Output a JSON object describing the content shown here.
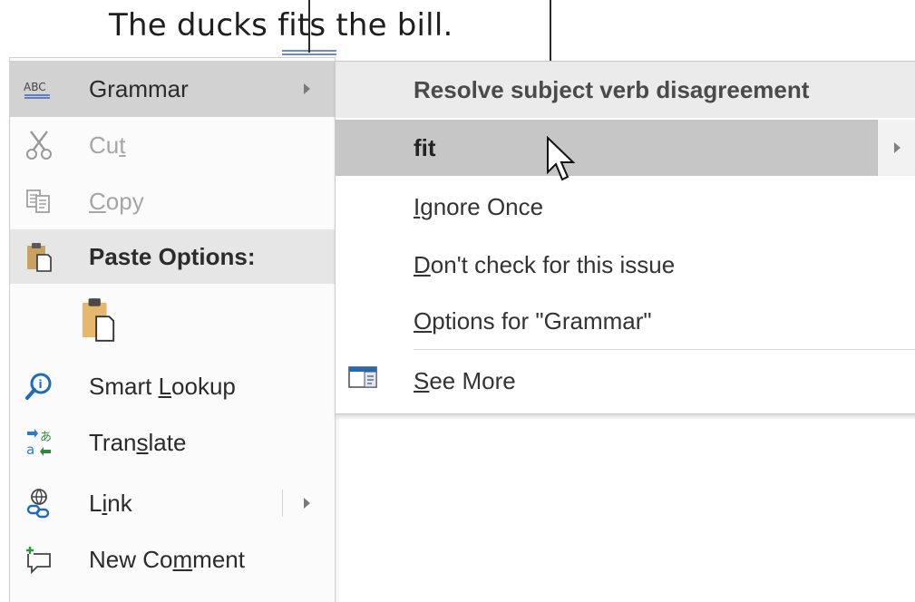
{
  "document": {
    "text_before": "The ducks ",
    "text_flagged": "fits",
    "text_after": " the bill."
  },
  "context_menu": {
    "items": [
      {
        "label": "Grammar",
        "icon": "abc-grammar-icon",
        "has_submenu": true
      },
      {
        "label": "Cut",
        "icon": "scissors-icon",
        "disabled": true
      },
      {
        "label": "Copy",
        "icon": "copy-icon",
        "disabled": true
      },
      {
        "label": "Paste Options:",
        "icon": "clipboard-icon"
      },
      {
        "label": "",
        "icon": "paste-keep-text-icon"
      },
      {
        "label": "Smart Lookup",
        "icon": "smart-lookup-icon"
      },
      {
        "label": "Translate",
        "icon": "translate-icon"
      },
      {
        "label": "Link",
        "icon": "link-icon",
        "has_submenu": true
      },
      {
        "label": "New Comment",
        "icon": "new-comment-icon"
      }
    ]
  },
  "grammar_submenu": {
    "title": "Resolve subject verb disagreement",
    "suggestion": "fit",
    "ignore_once": "Ignore Once",
    "dont_check": "Don't check for this issue",
    "options": "Options for \"Grammar\"",
    "see_more": "See More"
  },
  "colors": {
    "hover": "#d2d2d2",
    "highlight": "#c6c6c6",
    "squiggle": "#3b63c4"
  }
}
